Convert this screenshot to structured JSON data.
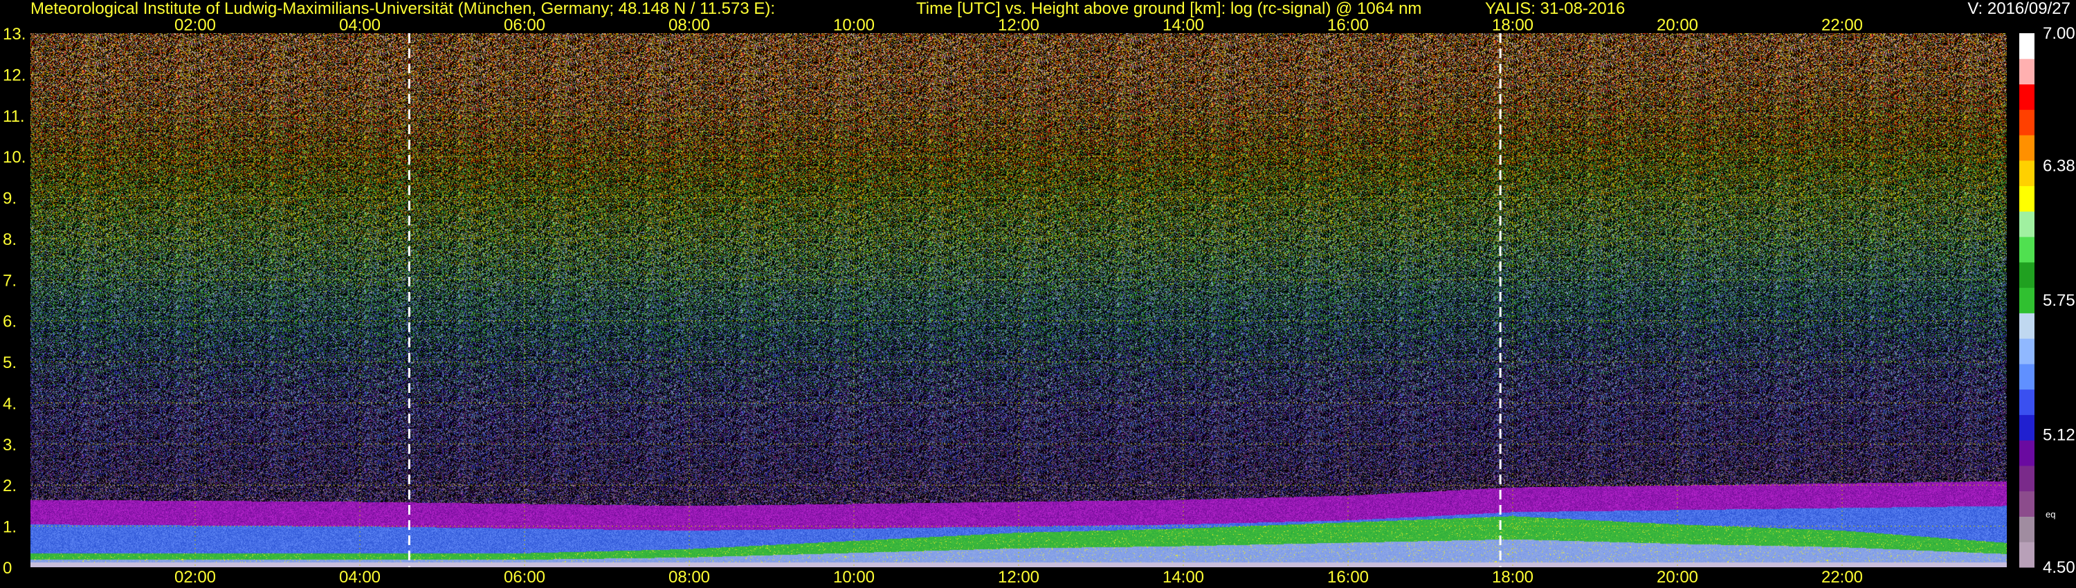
{
  "header": {
    "institute": "Meteorological Institute of Ludwig-Maximilians-Universität (München, Germany; 48.148 N / 11.573 E):",
    "plot_title": "Time [UTC] vs. Height above ground [km]: log (rc-signal) @ 1064 nm",
    "instrument_date": "YALIS: 31-08-2016",
    "version": "V: 2016/09/27"
  },
  "colors": {
    "background": "#000000",
    "text_yellow": "#ffff33",
    "grid": "#c8c800",
    "marker_lines": "#ffffff"
  },
  "colorbar": {
    "unit_label": "eq",
    "palette": [
      "#b8a0b8",
      "#a08ca0",
      "#8c4c8c",
      "#7a2a8a",
      "#6a0aa0",
      "#2020d0",
      "#3a50f0",
      "#6090ff",
      "#90b8ff",
      "#c0d8f0",
      "#30c030",
      "#20a020",
      "#50e050",
      "#a0f0a0",
      "#ffff00",
      "#ffd000",
      "#ff9000",
      "#ff4000",
      "#ff0000",
      "#ffb0b0",
      "#ffffff"
    ]
  },
  "chart_data": {
    "type": "heatmap",
    "title": "Time [UTC] vs. Height above ground [km]: log (rc-signal) @ 1064 nm",
    "xlabel": "Time [UTC]",
    "ylabel": "Height above ground [km]",
    "xlim_hours": [
      0,
      24
    ],
    "ylim_km": [
      0,
      13
    ],
    "x_tick_hours": [
      2,
      4,
      6,
      8,
      10,
      12,
      14,
      16,
      18,
      20,
      22
    ],
    "x_tick_labels": [
      "02:00",
      "04:00",
      "06:00",
      "08:00",
      "10:00",
      "12:00",
      "14:00",
      "16:00",
      "18:00",
      "20:00",
      "22:00"
    ],
    "y_ticks": [
      0,
      1,
      2,
      3,
      4,
      5,
      6,
      7,
      8,
      9,
      10,
      11,
      12,
      13
    ],
    "y_tick_labels": [
      "0",
      "1.",
      "2.",
      "3.",
      "4.",
      "5.",
      "6.",
      "7.",
      "8.",
      "9.",
      "10.",
      "11.",
      "12.",
      "13."
    ],
    "colorbar_range": [
      4.5,
      7.0
    ],
    "colorbar_tick_values": [
      4.5,
      5.12,
      5.75,
      6.38,
      7.0
    ],
    "colorbar_tick_labels": [
      "4.50",
      "5.12",
      "5.75",
      "6.38",
      "7.00"
    ],
    "grid": true,
    "vertical_markers_hours": [
      4.6,
      17.85
    ],
    "boundary_layer_top_km": [
      [
        0.0,
        1.05
      ],
      [
        4.0,
        1.0
      ],
      [
        6.0,
        0.95
      ],
      [
        8.0,
        0.9
      ],
      [
        10.0,
        0.95
      ],
      [
        12.0,
        1.0
      ],
      [
        14.0,
        1.05
      ],
      [
        16.0,
        1.15
      ],
      [
        18.0,
        1.35
      ],
      [
        20.0,
        1.4
      ],
      [
        22.0,
        1.45
      ],
      [
        24.0,
        1.5
      ]
    ],
    "green_layer_top_km": [
      [
        0.0,
        0.35
      ],
      [
        6.0,
        0.35
      ],
      [
        8.0,
        0.45
      ],
      [
        10.0,
        0.65
      ],
      [
        12.0,
        0.85
      ],
      [
        14.0,
        0.95
      ],
      [
        16.0,
        1.1
      ],
      [
        18.0,
        1.25
      ],
      [
        20.0,
        1.05
      ],
      [
        22.0,
        0.9
      ],
      [
        24.0,
        0.6
      ]
    ]
  }
}
